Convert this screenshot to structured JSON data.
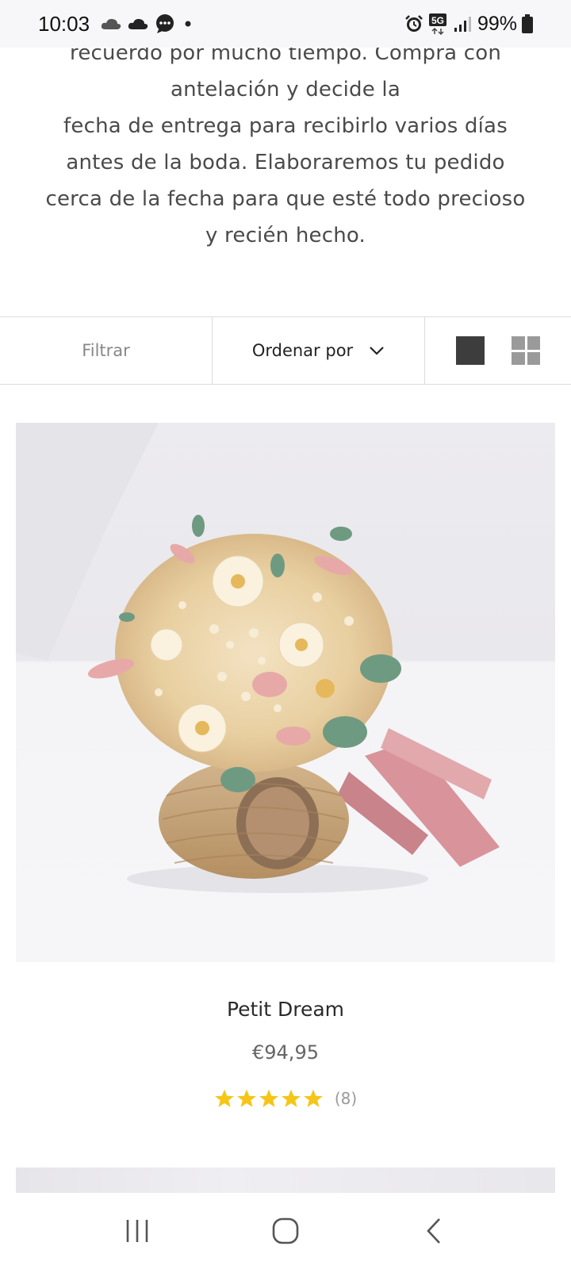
{
  "status_bar": {
    "time": "10:03",
    "battery": "99%",
    "network": "5G",
    "icons_left": [
      "cloud-icon",
      "cloud-icon",
      "chat-icon",
      "dot-icon"
    ],
    "icons_right": [
      "alarm-icon",
      "5g-icon",
      "signal-icon",
      "battery-icon"
    ]
  },
  "description": {
    "lines": [
      "recuerdo por mucho tiempo. Compra con",
      "antelación y decide la",
      "fecha de entrega para recibirlo varios días",
      "antes de la boda. Elaboraremos tu pedido",
      "cerca de la fecha para que esté todo precioso",
      "y recién hecho."
    ]
  },
  "toolbar": {
    "filter_label": "Filtrar",
    "sort_label": "Ordenar por",
    "view_single_icon": "single-view-icon",
    "view_grid_icon": "grid-view-icon"
  },
  "product": {
    "image_alt": "dried flower bouquet on twine spool",
    "name": "Petit Dream",
    "price": "€94,95",
    "rating": 5,
    "rating_max": 5,
    "review_count": "(8)",
    "star_color": "#f5c518"
  },
  "nav_bar": {
    "icons": [
      "recent-apps-icon",
      "home-icon",
      "back-icon"
    ]
  }
}
